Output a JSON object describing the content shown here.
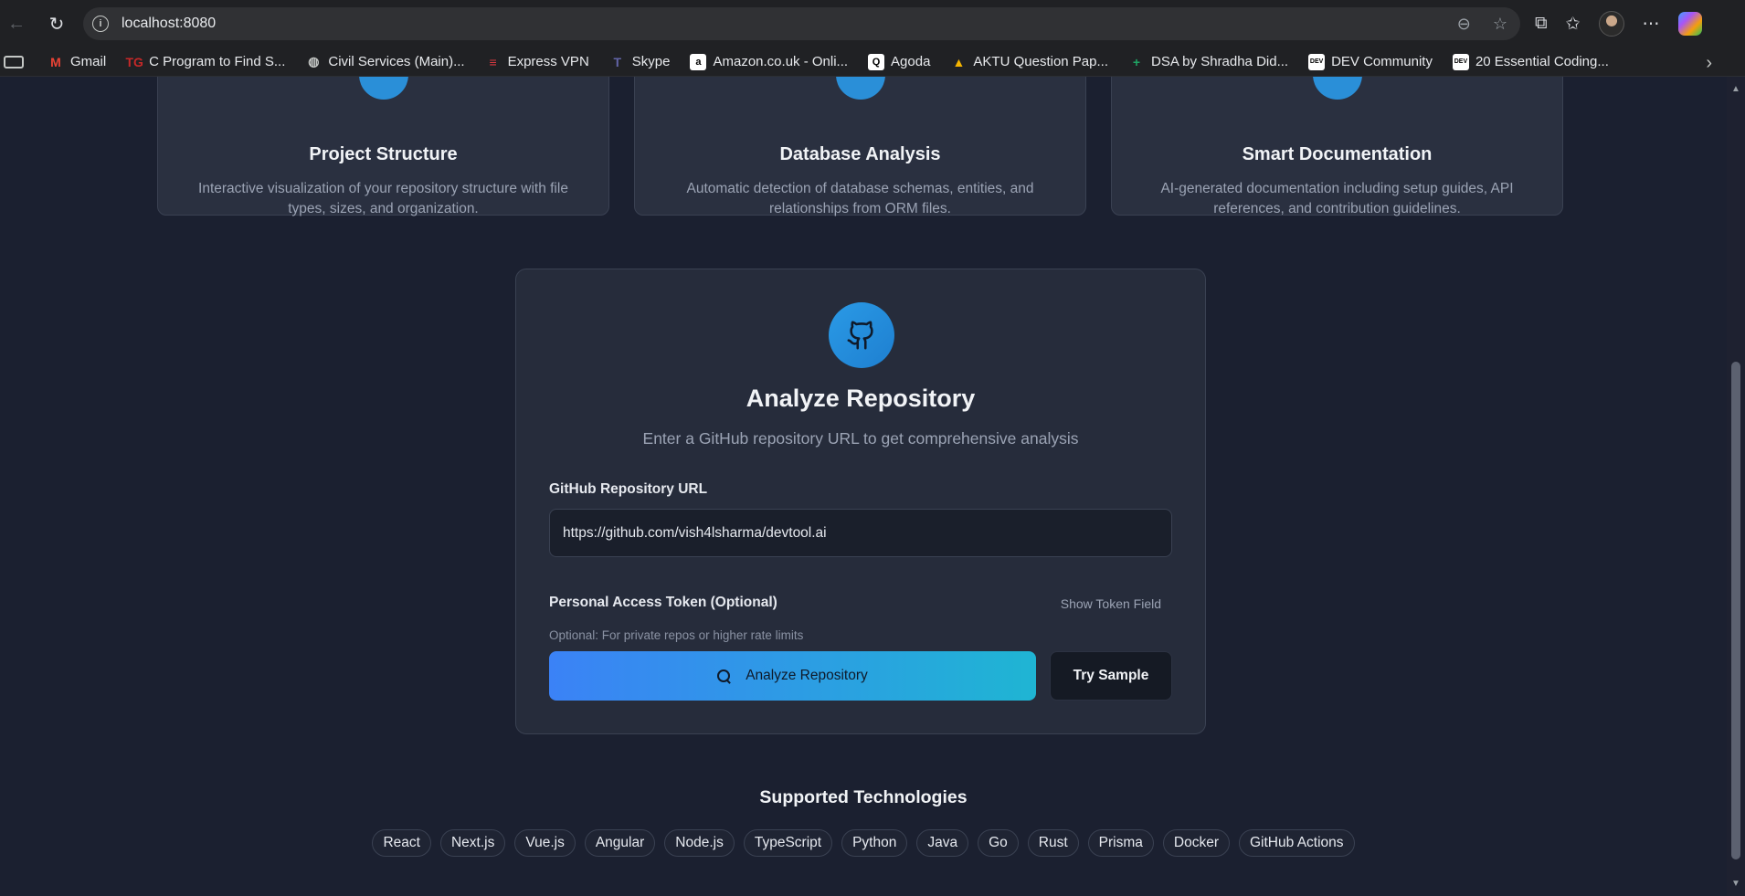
{
  "browser": {
    "url": "localhost:8080",
    "bookmarks": [
      {
        "label": "Gmail",
        "icon": "gmail-icon",
        "glyph": "M",
        "color": "#ea4335"
      },
      {
        "label": "C Program to Find S...",
        "icon": "tg-icon",
        "glyph": "TG",
        "color": "#c62828"
      },
      {
        "label": "Civil Services (Main)...",
        "icon": "globe-icon",
        "glyph": "◍",
        "color": "#c4c7c5"
      },
      {
        "label": "Express VPN",
        "icon": "expressvpn-icon",
        "glyph": "≡",
        "color": "#da3940"
      },
      {
        "label": "Skype",
        "icon": "teams-icon",
        "glyph": "T",
        "color": "#6264a7"
      },
      {
        "label": "Amazon.co.uk - Onli...",
        "icon": "amazon-icon",
        "glyph": "a",
        "color": "#ffffff"
      },
      {
        "label": "Agoda",
        "icon": "agoda-icon",
        "glyph": "Q",
        "color": "#ffffff"
      },
      {
        "label": "AKTU Question Pap...",
        "icon": "aktu-icon",
        "glyph": "▲",
        "color": "#f5b400"
      },
      {
        "label": "DSA by Shradha Did...",
        "icon": "sheets-icon",
        "glyph": "+",
        "color": "#1fa463"
      },
      {
        "label": "DEV Community",
        "icon": "dev-icon",
        "glyph": "DEV",
        "color": "#000000"
      },
      {
        "label": "20 Essential Coding...",
        "icon": "dev-icon",
        "glyph": "DEV",
        "color": "#000000"
      }
    ]
  },
  "features": [
    {
      "title": "Project Structure",
      "description": "Interactive visualization of your repository structure with file types, sizes, and organization."
    },
    {
      "title": "Database Analysis",
      "description": "Automatic detection of database schemas, entities, and relationships from ORM files."
    },
    {
      "title": "Smart Documentation",
      "description": "AI-generated documentation including setup guides, API references, and contribution guidelines."
    }
  ],
  "analyze": {
    "title": "Analyze Repository",
    "subtitle": "Enter a GitHub repository URL to get comprehensive analysis",
    "url_label": "GitHub Repository URL",
    "url_value": "https://github.com/vish4lsharma/devtool.ai",
    "token_label": "Personal Access Token (Optional)",
    "show_token": "Show Token Field",
    "token_hint": "Optional: For private repos or higher rate limits",
    "analyze_button": "Analyze Repository",
    "try_sample": "Try Sample"
  },
  "technologies": {
    "title": "Supported Technologies",
    "items": [
      "React",
      "Next.js",
      "Vue.js",
      "Angular",
      "Node.js",
      "TypeScript",
      "Python",
      "Java",
      "Go",
      "Rust",
      "Prisma",
      "Docker",
      "GitHub Actions"
    ]
  }
}
